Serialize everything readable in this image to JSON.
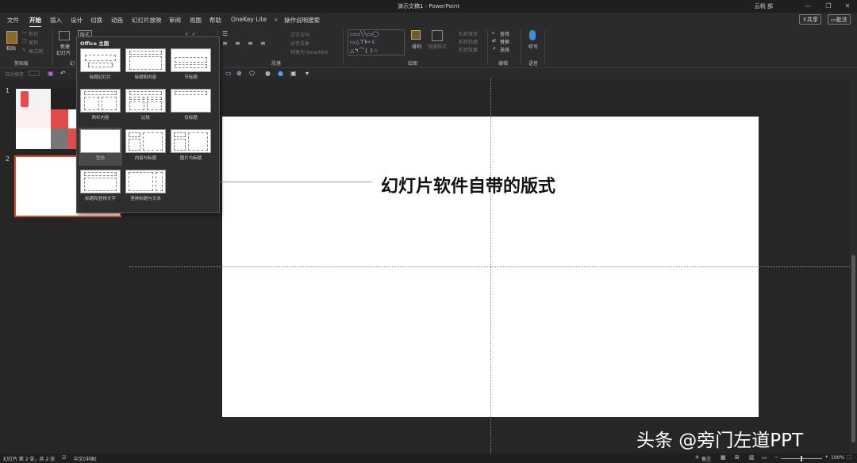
{
  "window": {
    "title": "演示文稿1 - PowerPoint",
    "user": "云帆 部",
    "minimize": "—",
    "restore": "❐",
    "close": "✕"
  },
  "menu": {
    "items": [
      "文件",
      "开始",
      "插入",
      "设计",
      "切换",
      "动画",
      "幻灯片放映",
      "审阅",
      "视图",
      "帮助",
      "OneKey Lite"
    ],
    "search": "操作说明搜索",
    "share": "共享",
    "comment": "批注"
  },
  "ribbon": {
    "paste": "粘贴",
    "cut": "剪切",
    "copy": "复制",
    "format_painter": "格式刷",
    "new_slide_line1": "新建",
    "new_slide_line2": "幻灯片",
    "layout_button": "版式",
    "text_direction": "文字方向",
    "align_text": "对齐文本",
    "smartart": "转换为 SmartArt",
    "arrange": "排列",
    "quick_styles": "快速样式",
    "shape_fill": "形状填充",
    "shape_outline": "形状轮廓",
    "shape_effects": "形状效果",
    "find": "查找",
    "replace": "替换",
    "select": "选择",
    "dictate": "听写",
    "groups": {
      "clipboard": "剪贴板",
      "slides": "幻",
      "paragraph": "段落",
      "drawing": "绘图",
      "editing": "编辑",
      "voice": "语音"
    }
  },
  "qat": {
    "autosave": "自动保存"
  },
  "layout_dropdown": {
    "header": "Office 主题",
    "items": [
      "标题幻灯片",
      "标题和内容",
      "节标题",
      "两栏内容",
      "比较",
      "仅标题",
      "空白",
      "内容与标题",
      "图片与标题",
      "标题和竖排文字",
      "竖排标题与文本"
    ],
    "selected": "空白"
  },
  "slides_pane": {
    "numbers": [
      "1",
      "2"
    ]
  },
  "annotation": "幻灯片软件自带的版式",
  "watermark": "头条 @旁门左道PPT",
  "status": {
    "slide_info": "幻灯片 第 2 张，共 2 张",
    "language": "中文(中国)",
    "notes": "备注",
    "zoom": "100%"
  }
}
